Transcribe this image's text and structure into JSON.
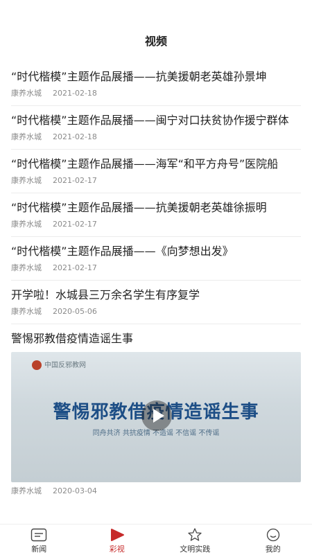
{
  "header": {
    "title": "视频"
  },
  "list": [
    {
      "title": "“时代楷模”主题作品展播——抗美援朝老英雄孙景坤",
      "source": "康养水城",
      "date": "2021-02-18"
    },
    {
      "title": "“时代楷模”主题作品展播——闽宁对口扶贫协作援宁群体",
      "source": "康养水城",
      "date": "2021-02-18"
    },
    {
      "title": "“时代楷模”主题作品展播——海军“和平方舟号”医院船",
      "source": "康养水城",
      "date": "2021-02-17"
    },
    {
      "title": "“时代楷模”主题作品展播——抗美援朝老英雄徐振明",
      "source": "康养水城",
      "date": "2021-02-17"
    },
    {
      "title": "“时代楷模”主题作品展播——《向梦想出发》",
      "source": "康养水城",
      "date": "2021-02-17"
    },
    {
      "title": "开学啦！水城县三万余名学生有序复学",
      "source": "康养水城",
      "date": "2020-05-06"
    }
  ],
  "video_item": {
    "title": "警惕邪教借疫情造谣生事",
    "thumbnail_logo_text": "中国反邪教网",
    "thumbnail_title": "警惕邪教借疫情造谣生事",
    "thumbnail_subtitle": "同舟共济  共抗疫情  不造谣  不信谣  不传谣",
    "source": "康养水城",
    "date": "2020-03-04"
  },
  "tabbar": {
    "active": "彩视",
    "tabs": [
      {
        "label": "新闻",
        "icon": "news-icon"
      },
      {
        "label": "彩视",
        "icon": "video-play-icon"
      },
      {
        "label": "文明实践",
        "icon": "star-icon"
      },
      {
        "label": "我的",
        "icon": "smile-profile-icon"
      }
    ]
  },
  "colors": {
    "accent": "#c62a2a",
    "meta_text": "#8a8a8a",
    "divider": "#ececec"
  }
}
